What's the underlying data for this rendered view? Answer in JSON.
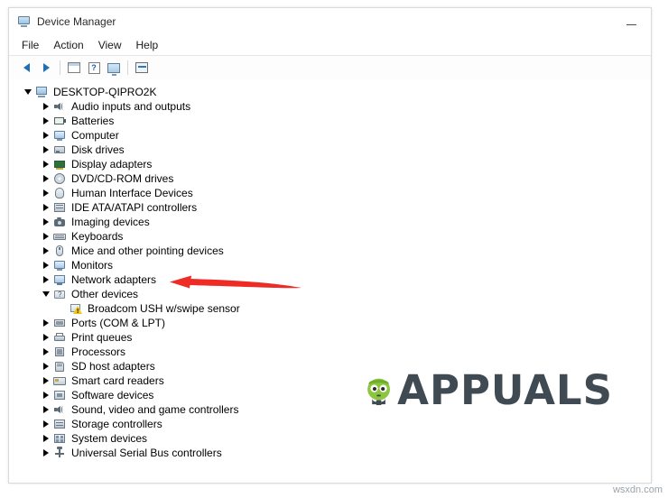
{
  "window": {
    "title": "Device Manager",
    "icon": "device-manager-icon",
    "minimize_label": "Minimize"
  },
  "menubar": {
    "items": [
      {
        "label": "File",
        "name": "menu-file"
      },
      {
        "label": "Action",
        "name": "menu-action"
      },
      {
        "label": "View",
        "name": "menu-view"
      },
      {
        "label": "Help",
        "name": "menu-help"
      }
    ]
  },
  "toolbar": {
    "buttons": [
      {
        "name": "back-button",
        "icon": "arrow-left-icon"
      },
      {
        "name": "forward-button",
        "icon": "arrow-right-icon"
      },
      {
        "name": "show-hide-console-tree-button",
        "icon": "console-tree-icon"
      },
      {
        "name": "properties-button",
        "icon": "properties-icon"
      },
      {
        "name": "update-driver-button",
        "icon": "monitor-icon"
      },
      {
        "name": "scan-hardware-changes-button",
        "icon": "scan-icon"
      }
    ]
  },
  "tree": {
    "root": {
      "label": "DESKTOP-QIPRO2K",
      "expanded": true,
      "icon": "computer-icon"
    },
    "nodes": [
      {
        "label": "Audio inputs and outputs",
        "icon": "audio-icon",
        "expanded": false,
        "indent": 1
      },
      {
        "label": "Batteries",
        "icon": "battery-icon",
        "expanded": false,
        "indent": 1
      },
      {
        "label": "Computer",
        "icon": "computer-node-icon",
        "expanded": false,
        "indent": 1
      },
      {
        "label": "Disk drives",
        "icon": "disk-drive-icon",
        "expanded": false,
        "indent": 1
      },
      {
        "label": "Display adapters",
        "icon": "display-adapter-icon",
        "expanded": false,
        "indent": 1
      },
      {
        "label": "DVD/CD-ROM drives",
        "icon": "dvd-drive-icon",
        "expanded": false,
        "indent": 1
      },
      {
        "label": "Human Interface Devices",
        "icon": "hid-icon",
        "expanded": false,
        "indent": 1
      },
      {
        "label": "IDE ATA/ATAPI controllers",
        "icon": "ide-controller-icon",
        "expanded": false,
        "indent": 1
      },
      {
        "label": "Imaging devices",
        "icon": "imaging-device-icon",
        "expanded": false,
        "indent": 1
      },
      {
        "label": "Keyboards",
        "icon": "keyboard-icon",
        "expanded": false,
        "indent": 1
      },
      {
        "label": "Mice and other pointing devices",
        "icon": "mouse-icon",
        "expanded": false,
        "indent": 1
      },
      {
        "label": "Monitors",
        "icon": "monitor-icon",
        "expanded": false,
        "indent": 1
      },
      {
        "label": "Network adapters",
        "icon": "network-adapter-icon",
        "expanded": false,
        "indent": 1
      },
      {
        "label": "Other devices",
        "icon": "other-devices-icon",
        "expanded": true,
        "indent": 1
      },
      {
        "label": "Broadcom USH w/swipe sensor",
        "icon": "warning-device-icon",
        "expanded": null,
        "indent": 2
      },
      {
        "label": "Ports (COM & LPT)",
        "icon": "port-icon",
        "expanded": false,
        "indent": 1
      },
      {
        "label": "Print queues",
        "icon": "printer-icon",
        "expanded": false,
        "indent": 1
      },
      {
        "label": "Processors",
        "icon": "processor-icon",
        "expanded": false,
        "indent": 1
      },
      {
        "label": "SD host adapters",
        "icon": "sd-host-adapter-icon",
        "expanded": false,
        "indent": 1
      },
      {
        "label": "Smart card readers",
        "icon": "smart-card-reader-icon",
        "expanded": false,
        "indent": 1
      },
      {
        "label": "Software devices",
        "icon": "software-device-icon",
        "expanded": false,
        "indent": 1
      },
      {
        "label": "Sound, video and game controllers",
        "icon": "sound-controller-icon",
        "expanded": false,
        "indent": 1
      },
      {
        "label": "Storage controllers",
        "icon": "storage-controller-icon",
        "expanded": false,
        "indent": 1
      },
      {
        "label": "System devices",
        "icon": "system-device-icon",
        "expanded": false,
        "indent": 1
      },
      {
        "label": "Universal Serial Bus controllers",
        "icon": "usb-controller-icon",
        "expanded": false,
        "indent": 1
      }
    ]
  },
  "annotation": {
    "arrow": {
      "name": "red-arrow-annotation",
      "color": "#ee2b24",
      "points_to": "Network adapters"
    }
  },
  "watermark": {
    "text": "APPUALS",
    "color": "#3f4a52",
    "mascot": "appuals-mascot-icon"
  },
  "footer": {
    "source_text": "wsxdn.com"
  }
}
